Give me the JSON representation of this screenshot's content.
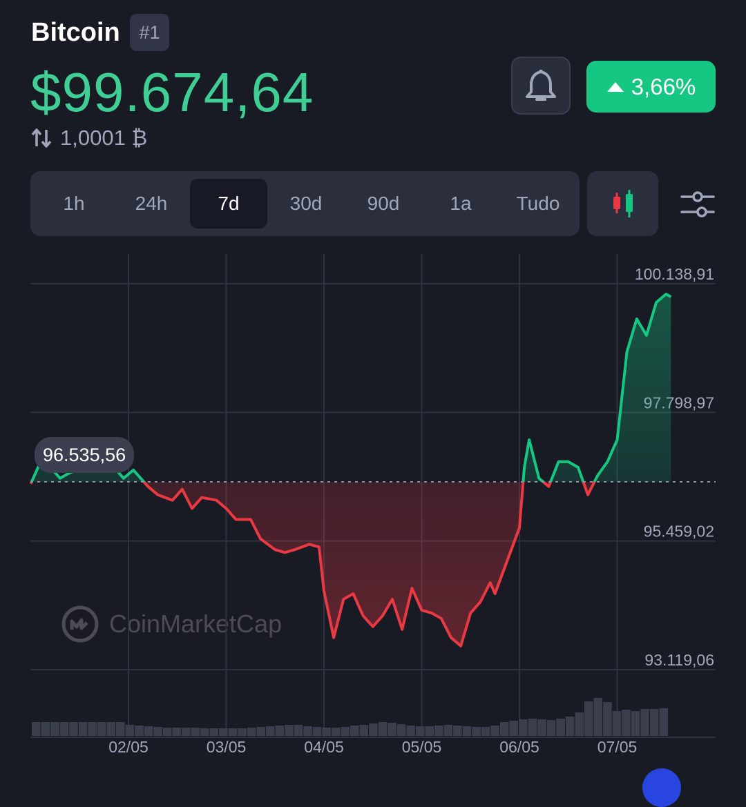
{
  "header": {
    "coin_name": "Bitcoin",
    "rank": "#1",
    "price": "$99.674,64",
    "change_pct": "3,66%",
    "conversion": "1,0001 ₿",
    "bell_icon": "bell-icon",
    "swap_icon": "swap-arrows-icon"
  },
  "ranges": [
    "1h",
    "24h",
    "7d",
    "30d",
    "90d",
    "1a",
    "Tudo"
  ],
  "active_range": "7d",
  "colors": {
    "background": "#181a24",
    "up": "#16c784",
    "down": "#ea3943",
    "price_text": "#3fcf94",
    "panel": "#2b2e3c"
  },
  "chart_data": {
    "type": "line",
    "x_ticks": [
      "02/05",
      "03/05",
      "04/05",
      "05/05",
      "06/05",
      "07/05"
    ],
    "y_ticks": [
      "100.138,91",
      "97.798,97",
      "95.459,02",
      "93.119,06"
    ],
    "y_tick_values": [
      100138.91,
      97798.97,
      95459.02,
      93119.06
    ],
    "baseline": 96535.56,
    "baseline_label": "96.535,56",
    "ylim": [
      93119.06,
      100138.91
    ],
    "x_range": [
      1.0,
      7.55
    ],
    "series": [
      {
        "points": [
          [
            1.0,
            96500
          ],
          [
            1.1,
            96900
          ],
          [
            1.2,
            96800
          ],
          [
            1.3,
            96600
          ],
          [
            1.4,
            96700
          ],
          [
            1.55,
            96800
          ],
          [
            1.65,
            97300
          ],
          [
            1.75,
            96900
          ],
          [
            1.85,
            96800
          ],
          [
            1.95,
            96600
          ],
          [
            2.05,
            96750
          ],
          [
            2.2,
            96450
          ],
          [
            2.3,
            96300
          ],
          [
            2.45,
            96200
          ],
          [
            2.55,
            96400
          ],
          [
            2.65,
            96050
          ],
          [
            2.75,
            96250
          ],
          [
            2.9,
            96200
          ],
          [
            3.0,
            96050
          ],
          [
            3.1,
            95850
          ],
          [
            3.25,
            95850
          ],
          [
            3.35,
            95500
          ],
          [
            3.5,
            95300
          ],
          [
            3.6,
            95250
          ],
          [
            3.7,
            95300
          ],
          [
            3.85,
            95400
          ],
          [
            3.95,
            95350
          ],
          [
            4.0,
            94550
          ],
          [
            4.1,
            93700
          ],
          [
            4.2,
            94400
          ],
          [
            4.3,
            94500
          ],
          [
            4.4,
            94100
          ],
          [
            4.5,
            93900
          ],
          [
            4.6,
            94100
          ],
          [
            4.7,
            94400
          ],
          [
            4.8,
            93850
          ],
          [
            4.9,
            94600
          ],
          [
            5.0,
            94200
          ],
          [
            5.1,
            94150
          ],
          [
            5.2,
            94050
          ],
          [
            5.3,
            93700
          ],
          [
            5.4,
            93550
          ],
          [
            5.5,
            94150
          ],
          [
            5.6,
            94350
          ],
          [
            5.7,
            94700
          ],
          [
            5.75,
            94500
          ],
          [
            6.0,
            95700
          ],
          [
            6.05,
            96800
          ],
          [
            6.1,
            97300
          ],
          [
            6.2,
            96600
          ],
          [
            6.3,
            96450
          ],
          [
            6.4,
            96900
          ],
          [
            6.5,
            96900
          ],
          [
            6.6,
            96800
          ],
          [
            6.7,
            96300
          ],
          [
            6.8,
            96650
          ],
          [
            6.9,
            96900
          ],
          [
            7.0,
            97300
          ],
          [
            7.1,
            98900
          ],
          [
            7.2,
            99500
          ],
          [
            7.3,
            99200
          ],
          [
            7.4,
            99800
          ],
          [
            7.5,
            99950
          ],
          [
            7.55,
            99900
          ]
        ]
      }
    ],
    "volume": [
      2,
      2,
      2,
      2,
      2,
      2,
      2,
      2,
      2,
      2,
      1.6,
      1.5,
      1.4,
      1.3,
      1.2,
      1.2,
      1.2,
      1.2,
      1.1,
      1.1,
      1.1,
      1.1,
      1.1,
      1.2,
      1.3,
      1.4,
      1.5,
      1.6,
      1.6,
      1.4,
      1.3,
      1.2,
      1.2,
      1.3,
      1.5,
      1.6,
      1.8,
      2.0,
      1.9,
      1.7,
      1.5,
      1.4,
      1.4,
      1.5,
      1.6,
      1.5,
      1.4,
      1.3,
      1.3,
      1.5,
      2.0,
      2.2,
      2.4,
      2.5,
      2.4,
      2.3,
      2.5,
      2.8,
      3.4,
      5.0,
      5.5,
      4.9,
      3.6,
      3.8,
      3.6,
      3.9,
      3.9,
      4.0
    ]
  },
  "watermark": "CoinMarketCap"
}
